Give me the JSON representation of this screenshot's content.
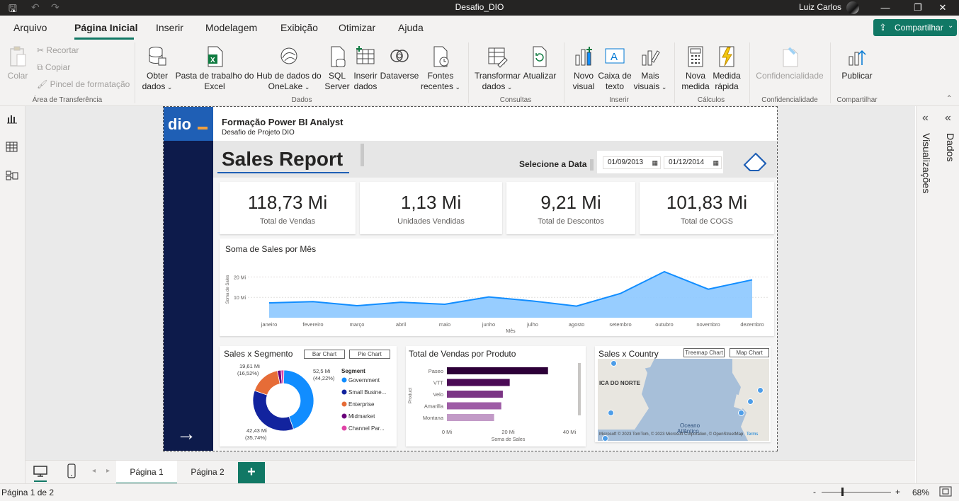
{
  "window": {
    "title": "Desafio_DIO",
    "user": "Luiz Carlos",
    "controls": [
      "—",
      "❐",
      "✕"
    ]
  },
  "menu": {
    "tabs": [
      "Arquivo",
      "Página Inicial",
      "Inserir",
      "Modelagem",
      "Exibição",
      "Otimizar",
      "Ajuda"
    ],
    "active": "Página Inicial",
    "share_label": "Compartilhar"
  },
  "ribbon": {
    "clipboard": {
      "paste": "Colar",
      "cut": "Recortar",
      "copy": "Copiar",
      "format_painter": "Pincel de formatação",
      "group": "Área de Transferência"
    },
    "data": {
      "get_data": [
        "Obter",
        "dados"
      ],
      "excel": [
        "Pasta de trabalho do",
        "Excel"
      ],
      "onelake": [
        "Hub de dados do",
        "OneLake"
      ],
      "sql": [
        "SQL",
        "Server"
      ],
      "enter_data": [
        "Inserir",
        "dados"
      ],
      "dataverse": [
        "Dataverse",
        ""
      ],
      "recent": [
        "Fontes",
        "recentes"
      ],
      "group": "Dados"
    },
    "queries": {
      "transform": [
        "Transformar",
        "dados"
      ],
      "refresh": [
        "Atualizar",
        ""
      ],
      "group": "Consultas"
    },
    "insert": {
      "new_visual": [
        "Novo",
        "visual"
      ],
      "text_box": [
        "Caixa de",
        "texto"
      ],
      "more_visuals": [
        "Mais",
        "visuais"
      ],
      "group": "Inserir"
    },
    "calc": {
      "new_measure": [
        "Nova",
        "medida"
      ],
      "quick_measure": [
        "Medida",
        "rápida"
      ],
      "group": "Cálculos"
    },
    "sensitivity": {
      "label": "Confidencialidade",
      "group": "Confidencialidade"
    },
    "share": {
      "publish": "Publicar",
      "group": "Compartilhar"
    }
  },
  "report": {
    "header_title": "Formação Power BI Analyst",
    "header_subtitle": "Desafio de Projeto DIO",
    "logo_text": "dio",
    "page_title": "Sales Report",
    "date_label": "Selecione a Data",
    "date_start": "01/09/2013",
    "date_end": "01/12/2014",
    "kpis": [
      {
        "value": "118,73 Mi",
        "label": "Total de Vendas"
      },
      {
        "value": "1,13 Mi",
        "label": "Unidades Vendidas"
      },
      {
        "value": "9,21 Mi",
        "label": "Total de Descontos"
      },
      {
        "value": "101,83 Mi",
        "label": "Total de COGS"
      }
    ]
  },
  "chart_data": [
    {
      "type": "area",
      "title": "Soma de Sales por Mês",
      "xlabel": "Mês",
      "ylabel": "Soma de Sales",
      "y_ticks": [
        "10 Mi",
        "20 Mi"
      ],
      "ylim": [
        0,
        25
      ],
      "categories": [
        "janeiro",
        "fevereiro",
        "março",
        "abril",
        "maio",
        "junho",
        "julho",
        "agosto",
        "setembro",
        "outubro",
        "novembro",
        "dezembro"
      ],
      "values": [
        7.3,
        7.9,
        5.9,
        7.6,
        6.6,
        10.2,
        8.2,
        5.7,
        11.9,
        22.6,
        14.0,
        18.6
      ],
      "color": "#118DFF",
      "fill": "#8CC8FF"
    },
    {
      "type": "pie",
      "title": "Sales x Segmento",
      "buttons": [
        "Bar Chart",
        "Pie Chart"
      ],
      "legend_title": "Segment",
      "slices": [
        {
          "name": "Government",
          "value": 52.5,
          "color": "#118DFF",
          "label": "52,5 Mi",
          "pct": "(44,22%)"
        },
        {
          "name": "Small Busine...",
          "value": 42.43,
          "color": "#12239E",
          "label": "42,43 Mi",
          "pct": "(35,74%)"
        },
        {
          "name": "Enterprise",
          "value": 19.61,
          "color": "#E66C37",
          "label": "19,61 Mi",
          "pct": "(16,52%)"
        },
        {
          "name": "Midmarket",
          "value": 2.4,
          "color": "#6B007B",
          "label": "",
          "pct": ""
        },
        {
          "name": "Channel Par...",
          "value": 1.8,
          "color": "#E044A7",
          "label": "",
          "pct": ""
        }
      ]
    },
    {
      "type": "bar",
      "title": "Total de Vendas por Produto",
      "xlabel": "Soma de Sales",
      "ylabel": "Product",
      "categories": [
        "Paseo",
        "VTT",
        "Velo",
        "Amarilla",
        "Montana"
      ],
      "values": [
        33.0,
        20.5,
        18.25,
        17.75,
        15.4
      ],
      "x_ticks": [
        "0 Mi",
        "20 Mi",
        "40 Mi"
      ],
      "xlim": [
        0,
        40
      ],
      "colors": [
        "#2D0038",
        "#4A0A55",
        "#7B3585",
        "#9E5CA6",
        "#C29AC7"
      ]
    },
    {
      "type": "map",
      "title": "Sales x Country",
      "buttons": [
        "Treemap Chart",
        "Map Chart"
      ],
      "map_labels": [
        "ICA DO NORTE",
        "Oceano",
        "Atlântico"
      ],
      "attribution": "Microsoft  © 2023 TomTom, © 2023 Microsoft Corporation, © OpenStreetMap",
      "terms": "Terms"
    }
  ],
  "pages": {
    "tabs": [
      "Página 1",
      "Página 2"
    ],
    "active": "Página 1",
    "add": "+"
  },
  "panes": {
    "visualizations": "Visualizações",
    "data": "Dados"
  },
  "status": {
    "page_info": "Página 1 de 2",
    "zoom": "68%",
    "zoom_minus": "-",
    "zoom_plus": "+"
  }
}
